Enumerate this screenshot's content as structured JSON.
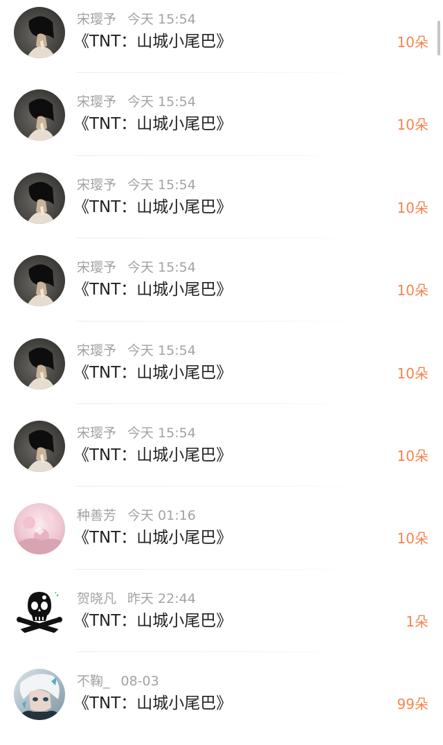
{
  "rows": [
    {
      "user": "宋璎予",
      "time": "今天 15:54",
      "title": "《TNT：山城小尾巴》",
      "amount": "10朵",
      "avatar": "dark-portrait"
    },
    {
      "user": "宋璎予",
      "time": "今天 15:54",
      "title": "《TNT：山城小尾巴》",
      "amount": "10朵",
      "avatar": "dark-portrait"
    },
    {
      "user": "宋璎予",
      "time": "今天 15:54",
      "title": "《TNT：山城小尾巴》",
      "amount": "10朵",
      "avatar": "dark-portrait"
    },
    {
      "user": "宋璎予",
      "time": "今天 15:54",
      "title": "《TNT：山城小尾巴》",
      "amount": "10朵",
      "avatar": "dark-portrait"
    },
    {
      "user": "宋璎予",
      "time": "今天 15:54",
      "title": "《TNT：山城小尾巴》",
      "amount": "10朵",
      "avatar": "dark-portrait"
    },
    {
      "user": "宋璎予",
      "time": "今天 15:54",
      "title": "《TNT：山城小尾巴》",
      "amount": "10朵",
      "avatar": "dark-portrait"
    },
    {
      "user": "种善芳",
      "time": "今天 01:16",
      "title": "《TNT：山城小尾巴》",
      "amount": "10朵",
      "avatar": "pink-blossom"
    },
    {
      "user": "贺晓凡",
      "time": "昨天 22:44",
      "title": "《TNT：山城小尾巴》",
      "amount": "1朵",
      "avatar": "skull"
    },
    {
      "user": "不鞠_",
      "time": "08-03",
      "title": "《TNT：山城小尾巴》",
      "amount": "99朵",
      "avatar": "anime-character"
    }
  ],
  "colors": {
    "amount": "#f5844c",
    "meta": "#a2a2a2",
    "title": "#222222"
  }
}
